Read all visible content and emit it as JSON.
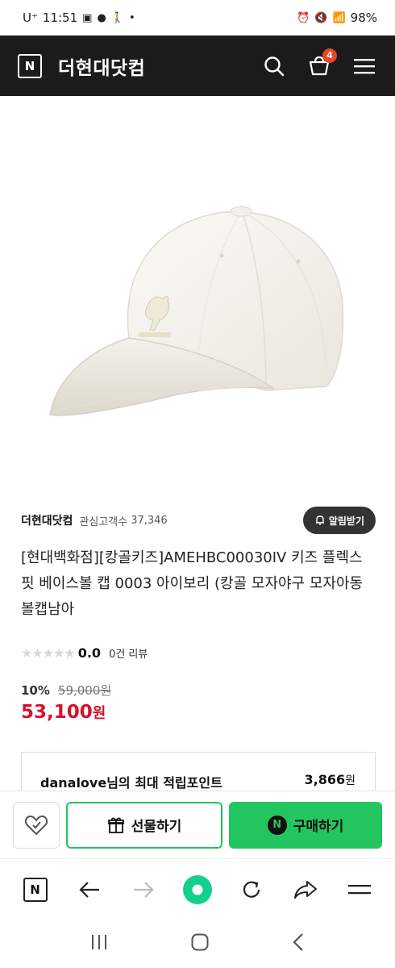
{
  "status_bar": {
    "carrier": "U⁺",
    "time": "11:51",
    "battery": "98%"
  },
  "header": {
    "logo_letter": "N",
    "brand": "더현대닷컴",
    "cart_count": "4"
  },
  "store": {
    "name": "더현대닷컴",
    "follower_label": "관심고객수",
    "follower_count": "37,346",
    "alarm_button": "알림받기"
  },
  "product": {
    "title": "[현대백화점][캉골키즈]AMEHBC00030IV 키즈 플렉스핏 베이스볼 캡 0003 아이보리 (캉골 모자야구 모자아동 볼캡남아",
    "rating_score": "0.0",
    "review_count": "0건 리뷰",
    "discount_rate": "10%",
    "original_price": "59,000원",
    "sale_price": "53,100",
    "sale_price_unit": "원"
  },
  "points": {
    "label": "danalove님의 최대 적립포인트",
    "value": "3,866",
    "unit": "원"
  },
  "actions": {
    "gift_label": "선물하기",
    "buy_label": "구매하기",
    "buy_badge": "N"
  },
  "browser_toolbar": {
    "home_letter": "N"
  },
  "colors": {
    "header_bg": "#1b1b1b",
    "sale_red": "#d4122b",
    "accent_green": "#22c55e",
    "badge_orange": "#e8452c"
  }
}
